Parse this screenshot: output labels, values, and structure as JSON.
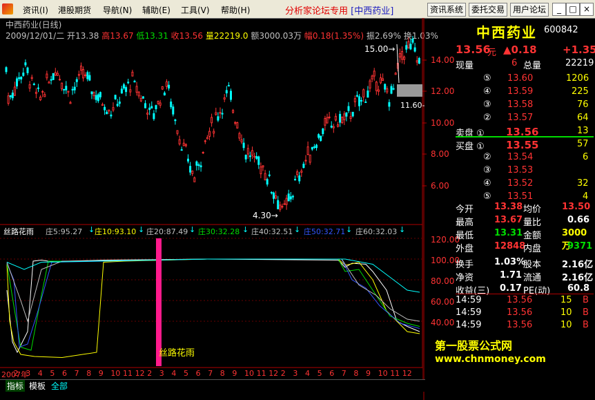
{
  "menubar": {
    "items": [
      "资讯(I)",
      "港股期货",
      "导航(N)",
      "辅助(E)",
      "工具(V)",
      "帮助(H)"
    ],
    "promo": "分析家论坛专用",
    "promo_stock": "[中西药业]",
    "tools": [
      "资讯系统",
      "委托交易",
      "用户论坛"
    ],
    "window_buttons": [
      "_",
      "□",
      "×"
    ]
  },
  "info": {
    "title": "中西药业(日线)",
    "date": "2009/12/01/二",
    "open_label": "开",
    "open": "13.38",
    "high_label": "高",
    "high": "13.67",
    "low_label": "低",
    "low": "13.31",
    "close_label": "收",
    "close": "13.56",
    "vol_label": "量",
    "vol": "22219.0",
    "amt_label": "额",
    "amt": "3000.03万",
    "chg_label": "幅",
    "chg": "0.18(1.35%)",
    "amp_label": "振",
    "amp": "2.69%",
    "turn_label": "换",
    "turn": "1.03%"
  },
  "price_axis": [
    "14.00",
    "12.00",
    "10.00",
    "8.00",
    "6.00"
  ],
  "price_annotations": {
    "high": "15.00",
    "low": "4.30",
    "box": "11.60"
  },
  "indicator": {
    "name": "丝路花雨",
    "values": [
      {
        "label": "庄5:95.27",
        "color": "#c0c0c0"
      },
      {
        "label": "庄10:93.10",
        "color": "#ffff00"
      },
      {
        "label": "庄20:87.49",
        "color": "#c0c0c0"
      },
      {
        "label": "庄30:32.28",
        "color": "#00dd00"
      },
      {
        "label": "庄40:32.51",
        "color": "#c0c0c0"
      },
      {
        "label": "庄50:32.71",
        "color": "#3355ff"
      },
      {
        "label": "庄60:32.03",
        "color": "#c0c0c0"
      }
    ],
    "axis": [
      "120.00",
      "100.00",
      "80.00",
      "60.00",
      "40.00"
    ],
    "watermark": "丝路花雨"
  },
  "date_axis": [
    "2007年",
    "2",
    "3",
    "4",
    "5",
    "6",
    "7",
    "8",
    "9",
    "10",
    "11",
    "12",
    "2",
    "3",
    "4",
    "5",
    "6",
    "7",
    "8",
    "9",
    "10",
    "11",
    "12",
    "2",
    "3",
    "4",
    "5",
    "6",
    "7",
    "8",
    "9",
    "10",
    "11",
    "12"
  ],
  "bottom_tabs": [
    "指标",
    "模板",
    "全部"
  ],
  "quote": {
    "name": "中西药业",
    "code": "600842",
    "price": "13.56",
    "price_unit": "元",
    "change": "▲0.18",
    "change2": "+1.35",
    "xianliang_label": "现量",
    "xianliang": "6",
    "zongliang_label": "总量",
    "zongliang": "22219",
    "asks": [
      {
        "label": "⑤",
        "price": "13.60",
        "vol": "1206"
      },
      {
        "label": "④",
        "price": "13.59",
        "vol": "225"
      },
      {
        "label": "③",
        "price": "13.58",
        "vol": "76"
      },
      {
        "label": "②",
        "price": "13.57",
        "vol": "64"
      },
      {
        "label": "卖盘 ①",
        "price": "13.56",
        "vol": "13"
      }
    ],
    "bids": [
      {
        "label": "买盘 ①",
        "price": "13.55",
        "vol": "57"
      },
      {
        "label": "②",
        "price": "13.54",
        "vol": "6"
      },
      {
        "label": "③",
        "price": "13.53",
        "vol": ""
      },
      {
        "label": "④",
        "price": "13.52",
        "vol": "32"
      },
      {
        "label": "⑤",
        "price": "13.51",
        "vol": "4"
      }
    ],
    "stats": [
      {
        "k1": "今开",
        "v1": "13.38",
        "k2": "均价",
        "v2": "13.50"
      },
      {
        "k1": "最高",
        "v1": "13.67",
        "k2": "量比",
        "v2": "0.66"
      },
      {
        "k1": "最低",
        "v1": "13.31",
        "k2": "金额",
        "v2": "3000万"
      },
      {
        "k1": "外盘",
        "v1": "12848",
        "k2": "内盘",
        "v2": "9371"
      },
      {
        "k1": "换手",
        "v1": "1.03%",
        "k2": "股本",
        "v2": "2.16亿"
      },
      {
        "k1": "净资",
        "v1": "1.71",
        "k2": "流通",
        "v2": "2.16亿"
      },
      {
        "k1": "收益(三)",
        "v1": "0.17",
        "k2": "PE(动)",
        "v2": "60.8"
      }
    ],
    "ticks": [
      {
        "time": "14:59",
        "price": "13.56",
        "vol": "15",
        "dir": "B"
      },
      {
        "time": "14:59",
        "price": "13.56",
        "vol": "10",
        "dir": "B"
      },
      {
        "time": "14:59",
        "price": "13.56",
        "vol": "10",
        "dir": "B"
      }
    ]
  },
  "ad": {
    "line1": "第一股票公式网",
    "line2": "www.chnmoney.com"
  },
  "colors": {
    "up": "#ff3333",
    "down": "#00ffff",
    "panel_border": "#b00000",
    "accent": "#ff1a8c"
  }
}
